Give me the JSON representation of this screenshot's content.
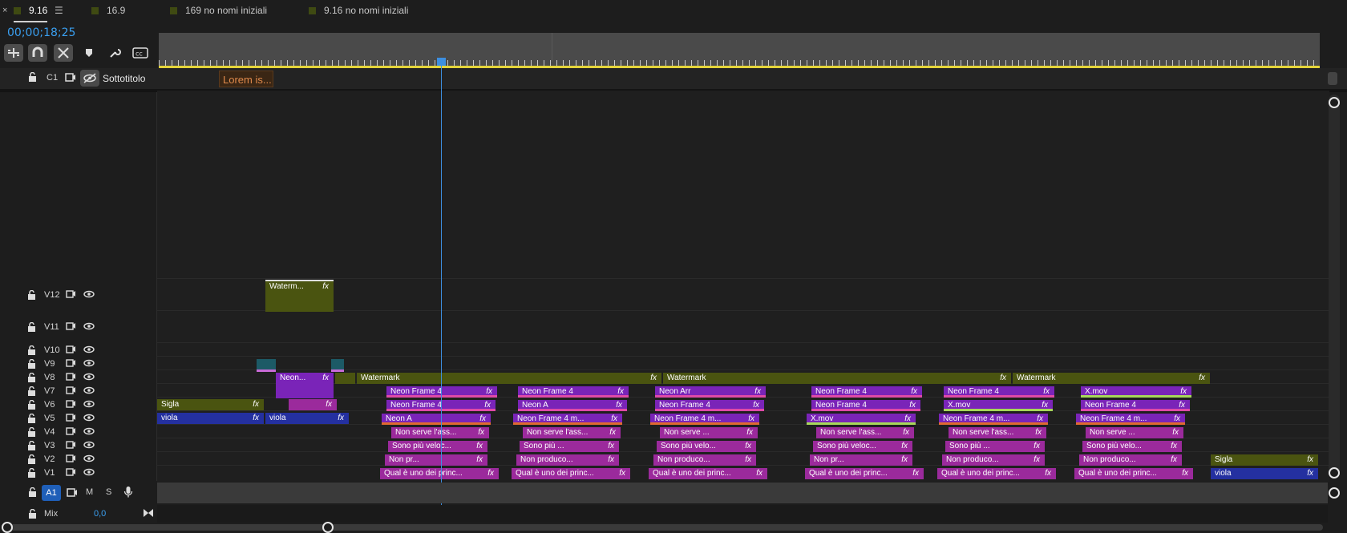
{
  "tabs": [
    {
      "label": "9.16",
      "active": true
    },
    {
      "label": "16.9"
    },
    {
      "label": "169 no nomi iniziali"
    },
    {
      "label": "9.16 no nomi iniziali"
    }
  ],
  "timecode": "00;00;18;25",
  "caption_track": {
    "name": "C1",
    "label": "Sottotitolo",
    "clip": "Lorem is..."
  },
  "tracks": [
    "V12",
    "V11",
    "V10",
    "V9",
    "V8",
    "V7",
    "V6",
    "V5",
    "V4",
    "V3",
    "V2",
    "V1"
  ],
  "audio": {
    "track": "A1",
    "m": "M",
    "s": "S",
    "mix_label": "Mix",
    "mix_value": "0,0"
  },
  "clips": {
    "watermark_v12": "Waterm...",
    "neon_v8": "Neon...",
    "watermark_1": "Watermark",
    "watermark_2": "Watermark",
    "watermark_3": "Watermark",
    "sigla": "Sigla",
    "viola": "viola",
    "viola2": "viola",
    "sigla_end": "Sigla",
    "viola_end": "viola",
    "nf4": "Neon Frame 4",
    "neon_a": "Neon A",
    "neon_arr": "Neon Arr",
    "nf4m": "Neon Frame 4 m...",
    "xmov": "X.mov",
    "non_serve": "Non serve l'ass...",
    "non_serve2": "Non serve ...",
    "sono_piu": "Sono più veloc...",
    "sono_piu2": "Sono più ...",
    "sono_piu3": "Sono più velo...",
    "non_pr": "Non pr...",
    "non_produco": "Non produco...",
    "qual": "Qual è uno dei princ..."
  },
  "fx_label": "fx"
}
